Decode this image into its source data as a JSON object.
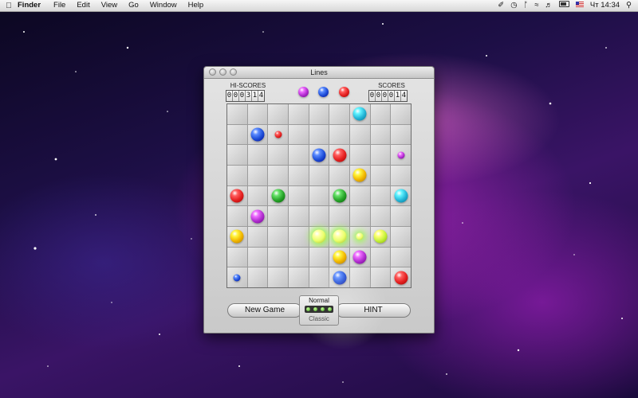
{
  "menubar": {
    "app_name": "Finder",
    "items": [
      "File",
      "Edit",
      "View",
      "Go",
      "Window",
      "Help"
    ],
    "clock": "Чт 14:34"
  },
  "window": {
    "title": "Lines"
  },
  "scores": {
    "hi_label": "HI-SCORES",
    "hi_digits": [
      "0",
      "0",
      "0",
      "3",
      "1",
      "4"
    ],
    "score_label": "SCORES",
    "score_digits": [
      "0",
      "0",
      "0",
      "0",
      "1",
      "4"
    ]
  },
  "next_balls": [
    "purple",
    "blue",
    "red"
  ],
  "ball_colors": {
    "red": "#e52222",
    "blue": "#1f4fd8",
    "green": "#29a52b",
    "cyan": "#25b7d8",
    "yellow": "#f2b800",
    "purple": "#b22fd0",
    "lime": "#c6f23a",
    "spark": "#e8ff6a"
  },
  "board": {
    "rows": 9,
    "cols": 9,
    "balls": [
      {
        "r": 0,
        "c": 6,
        "color": "cyan",
        "size": "big"
      },
      {
        "r": 1,
        "c": 1,
        "color": "blue",
        "size": "big"
      },
      {
        "r": 1,
        "c": 2,
        "color": "red",
        "size": "small"
      },
      {
        "r": 2,
        "c": 4,
        "color": "blue",
        "size": "big"
      },
      {
        "r": 2,
        "c": 5,
        "color": "red",
        "size": "big"
      },
      {
        "r": 2,
        "c": 8,
        "color": "purple",
        "size": "small"
      },
      {
        "r": 3,
        "c": 6,
        "color": "yellow",
        "size": "big"
      },
      {
        "r": 4,
        "c": 0,
        "color": "red",
        "size": "big"
      },
      {
        "r": 4,
        "c": 2,
        "color": "green",
        "size": "big"
      },
      {
        "r": 4,
        "c": 5,
        "color": "green",
        "size": "big"
      },
      {
        "r": 4,
        "c": 8,
        "color": "cyan",
        "size": "big"
      },
      {
        "r": 5,
        "c": 1,
        "color": "purple",
        "size": "big"
      },
      {
        "r": 6,
        "c": 0,
        "color": "yellow",
        "size": "big"
      },
      {
        "r": 6,
        "c": 4,
        "color": "spark",
        "size": "big"
      },
      {
        "r": 6,
        "c": 5,
        "color": "spark",
        "size": "big"
      },
      {
        "r": 6,
        "c": 6,
        "color": "spark",
        "size": "small"
      },
      {
        "r": 6,
        "c": 7,
        "color": "lime",
        "size": "big"
      },
      {
        "r": 7,
        "c": 5,
        "color": "yellow",
        "size": "big"
      },
      {
        "r": 7,
        "c": 6,
        "color": "purple",
        "size": "big"
      },
      {
        "r": 8,
        "c": 0,
        "color": "blue",
        "size": "small"
      },
      {
        "r": 8,
        "c": 5,
        "color": "blue",
        "size": "big"
      },
      {
        "r": 8,
        "c": 8,
        "color": "red",
        "size": "big"
      }
    ]
  },
  "controls": {
    "new_game": "New Game",
    "hint": "HINT",
    "mode_top": "Normal",
    "mode_bottom": "Classic"
  }
}
